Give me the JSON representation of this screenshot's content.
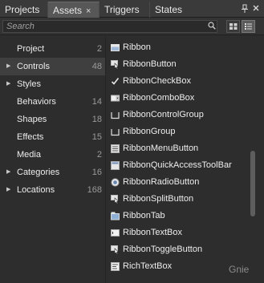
{
  "tabs": [
    {
      "label": "Projects"
    },
    {
      "label": "Assets"
    },
    {
      "label": "Triggers"
    },
    {
      "label": "States"
    }
  ],
  "tab_close_glyph": "×",
  "search": {
    "placeholder": "Search"
  },
  "categories": [
    {
      "label": "Project",
      "count": "2",
      "expandable": false
    },
    {
      "label": "Controls",
      "count": "48",
      "expandable": true,
      "selected": true
    },
    {
      "label": "Styles",
      "count": "",
      "expandable": true
    },
    {
      "label": "Behaviors",
      "count": "14",
      "expandable": false
    },
    {
      "label": "Shapes",
      "count": "18",
      "expandable": false
    },
    {
      "label": "Effects",
      "count": "15",
      "expandable": false
    },
    {
      "label": "Media",
      "count": "2",
      "expandable": false
    },
    {
      "label": "Categories",
      "count": "16",
      "expandable": true
    },
    {
      "label": "Locations",
      "count": "168",
      "expandable": true
    }
  ],
  "assets": [
    {
      "label": "Ribbon",
      "icon": "ribbon-icon"
    },
    {
      "label": "RibbonButton",
      "icon": "ribbon-button-icon"
    },
    {
      "label": "RibbonCheckBox",
      "icon": "checkbox-icon"
    },
    {
      "label": "RibbonComboBox",
      "icon": "combobox-icon"
    },
    {
      "label": "RibbonControlGroup",
      "icon": "control-group-icon"
    },
    {
      "label": "RibbonGroup",
      "icon": "group-icon"
    },
    {
      "label": "RibbonMenuButton",
      "icon": "menu-button-icon"
    },
    {
      "label": "RibbonQuickAccessToolBar",
      "icon": "toolbar-icon"
    },
    {
      "label": "RibbonRadioButton",
      "icon": "radio-button-icon"
    },
    {
      "label": "RibbonSplitButton",
      "icon": "split-button-icon"
    },
    {
      "label": "RibbonTab",
      "icon": "tab-icon"
    },
    {
      "label": "RibbonTextBox",
      "icon": "textbox-icon"
    },
    {
      "label": "RibbonToggleButton",
      "icon": "toggle-button-icon"
    },
    {
      "label": "RichTextBox",
      "icon": "richtextbox-icon"
    }
  ],
  "watermark": "Gnie",
  "colors": {
    "background": "#2d2d2d",
    "selected_row": "#3f3f3f",
    "active_tab": "#575757"
  }
}
